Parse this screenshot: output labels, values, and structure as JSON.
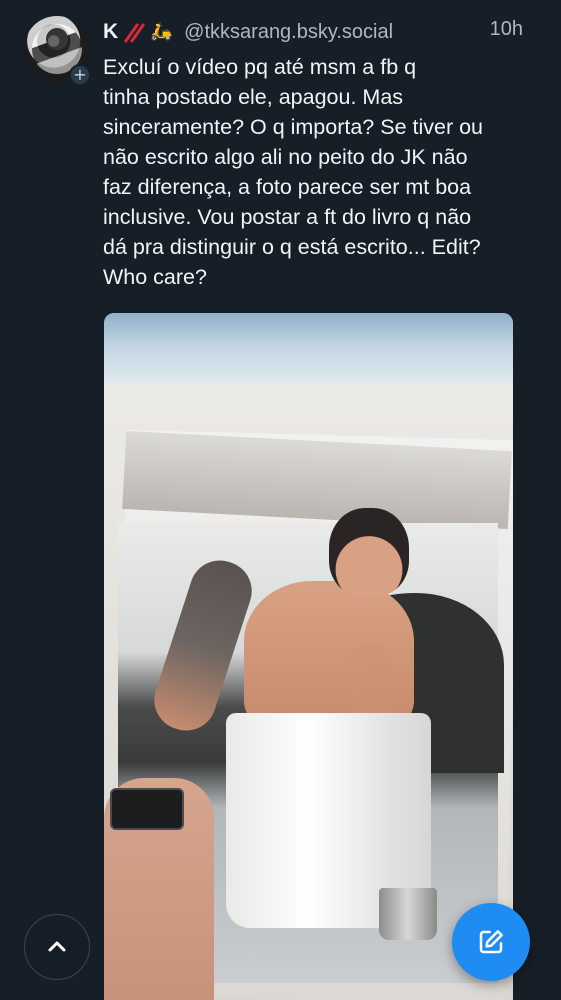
{
  "post": {
    "author": {
      "display_name": "K",
      "name_emojis": [
        "slashes-emoji",
        "scooter-emoji"
      ],
      "handle": "@tkksarang.bsky.social"
    },
    "time": "10h",
    "text": "Excluí o vídeo pq até msm a fb q\ntinha postado ele, apagou. Mas\nsinceramente? O q importa? Se tiver ou\nnão escrito algo ali no peito do JK não\nfaz diferença, a foto parece ser mt boa\ninclusive. Vou postar a ft do livro q não\ndá pra distinguir o q está escrito... Edit?\nWho care?",
    "follow_badge": "+"
  },
  "controls": {
    "scroll_top_icon": "chevron-up-icon",
    "compose_icon": "pencil-square-icon"
  },
  "colors": {
    "background": "#161e27",
    "accent": "#1e8cf2",
    "secondary_text": "#aeb8c3"
  }
}
